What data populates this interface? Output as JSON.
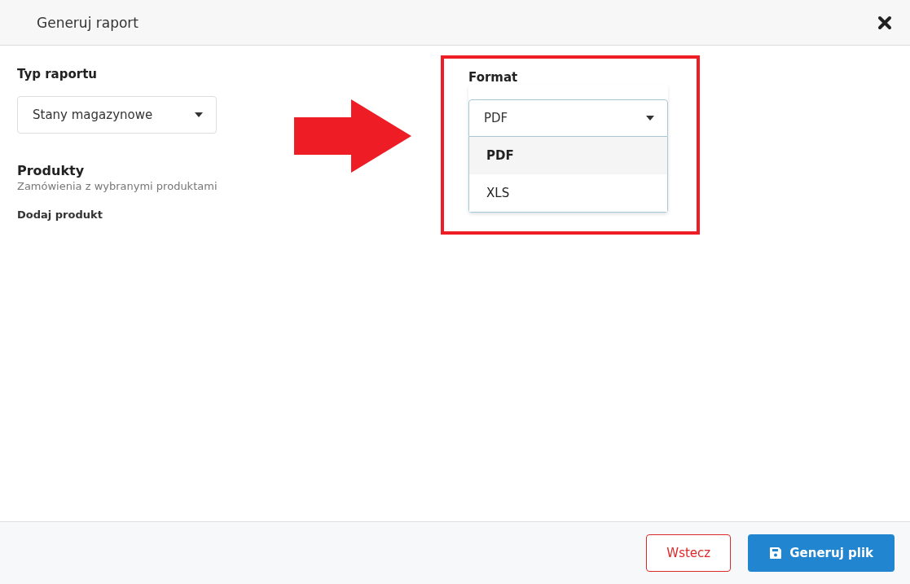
{
  "dialog": {
    "title": "Generuj raport"
  },
  "report_type": {
    "label": "Typ raportu",
    "value": "Stany magazynowe"
  },
  "products": {
    "title": "Produkty",
    "subtitle": "Zamówienia z wybranymi produktami",
    "add_link": "Dodaj produkt"
  },
  "format": {
    "label": "Format",
    "value": "PDF",
    "expanded": true,
    "options": [
      {
        "label": "PDF",
        "selected": true
      },
      {
        "label": "XLS",
        "selected": false
      }
    ]
  },
  "buttons": [
    {
      "kind": "secondary",
      "label": "Wstecz"
    },
    {
      "kind": "primary",
      "label": "Generuj plik"
    }
  ]
}
